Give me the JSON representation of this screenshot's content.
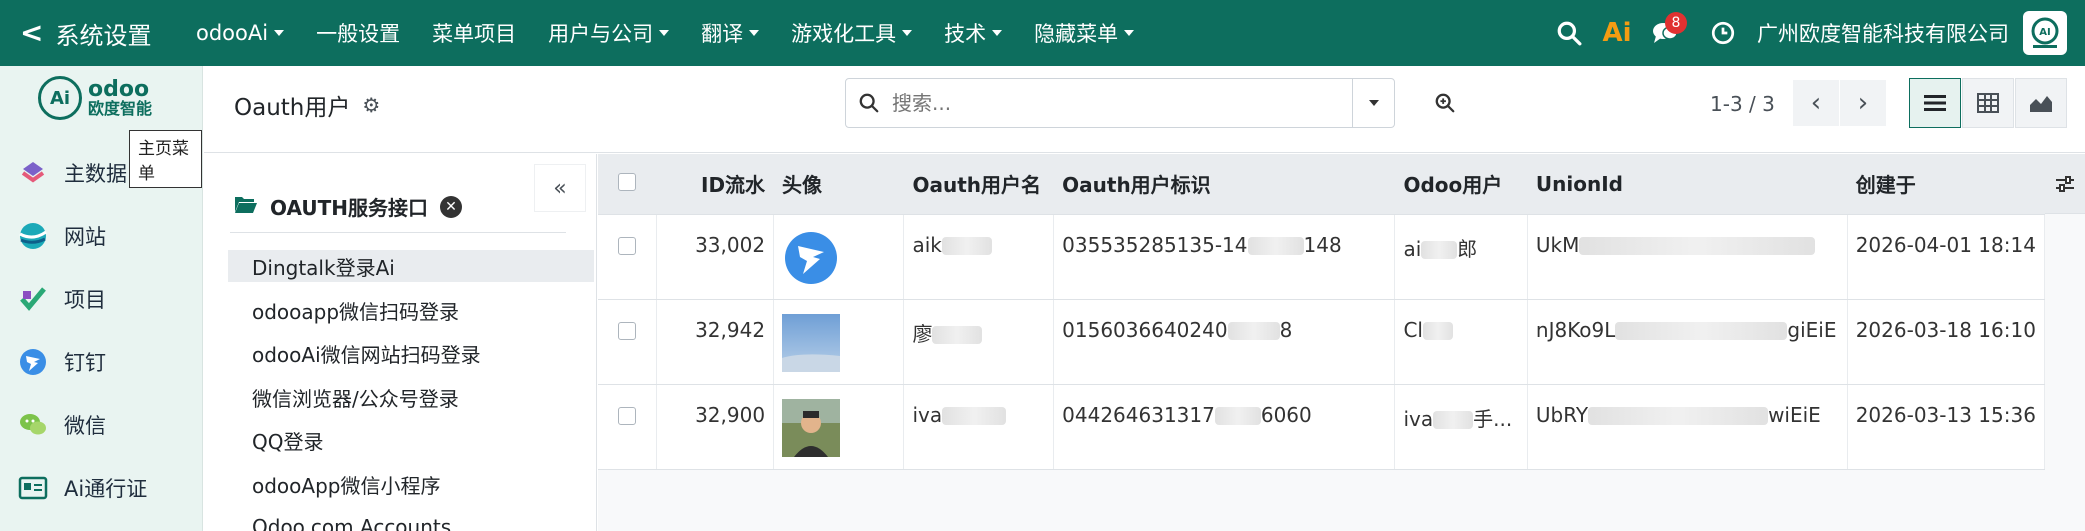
{
  "navbar": {
    "back_title": "系统设置",
    "menu": [
      {
        "label": "odooAi",
        "dropdown": true
      },
      {
        "label": "一般设置",
        "dropdown": false
      },
      {
        "label": "菜单项目",
        "dropdown": false
      },
      {
        "label": "用户与公司",
        "dropdown": true
      },
      {
        "label": "翻译",
        "dropdown": true
      },
      {
        "label": "游戏化工具",
        "dropdown": true
      },
      {
        "label": "技术",
        "dropdown": true
      },
      {
        "label": "隐藏菜单",
        "dropdown": true
      }
    ],
    "ai_label": "Ai",
    "message_count": "8",
    "company": "广州欧度智能科技有限公司",
    "accent_color": "#0d6e5e"
  },
  "sidebar": {
    "logo_text": "odoo",
    "logo_subtext": "欧度智能",
    "tooltip": "主页菜单",
    "apps": [
      {
        "label": "主数据",
        "icon": "master-data-icon"
      },
      {
        "label": "网站",
        "icon": "website-icon"
      },
      {
        "label": "项目",
        "icon": "project-icon"
      },
      {
        "label": "钉钉",
        "icon": "dingtalk-icon"
      },
      {
        "label": "微信",
        "icon": "wechat-icon"
      },
      {
        "label": "Ai通行证",
        "icon": "ai-pass-icon"
      }
    ]
  },
  "control_panel": {
    "title": "Oauth用户",
    "search_placeholder": "搜索...",
    "pager": "1-3 / 3"
  },
  "search_panel": {
    "heading": "OAUTH服务接口",
    "items": [
      {
        "label": "Dingtalk登录Ai",
        "active": true
      },
      {
        "label": "odooapp微信扫码登录",
        "active": false
      },
      {
        "label": "odooAi微信网站扫码登录",
        "active": false
      },
      {
        "label": "微信浏览器/公众号登录",
        "active": false
      },
      {
        "label": "QQ登录",
        "active": false
      },
      {
        "label": "odooApp微信小程序",
        "active": false
      },
      {
        "label": "Odoo.com Accounts",
        "active": false
      }
    ]
  },
  "list": {
    "columns": [
      "ID流水",
      "头像",
      "Oauth用户名",
      "Oauth用户标识",
      "Odoo用户",
      "UnionId",
      "创建于"
    ],
    "rows": [
      {
        "id": "33,002",
        "avatar": "dingtalk-logo",
        "name_prefix": "aik",
        "oauth_uid_a": "035535285135-14",
        "oauth_uid_b": "148",
        "user_prefix": "ai",
        "user_suffix": "郎",
        "unionid_prefix": "UkM",
        "unionid_suffix": "",
        "created": "2026-04-01 18:14"
      },
      {
        "id": "32,942",
        "avatar": "sky-photo",
        "name_prefix": "廖",
        "oauth_uid_a": "0156036640240",
        "oauth_uid_b": "8",
        "user_prefix": "Cl",
        "user_suffix": "",
        "unionid_prefix": "nJ8Ko9L",
        "unionid_suffix": "giEiE",
        "created": "2026-03-18 16:10"
      },
      {
        "id": "32,900",
        "avatar": "person-photo",
        "name_prefix": "iva",
        "oauth_uid_a": "044264631317",
        "oauth_uid_b": "6060",
        "user_prefix": "iva",
        "user_suffix": "手...",
        "unionid_prefix": "UbRY",
        "unionid_suffix": "wiEiE",
        "created": "2026-03-13 15:36"
      }
    ]
  }
}
